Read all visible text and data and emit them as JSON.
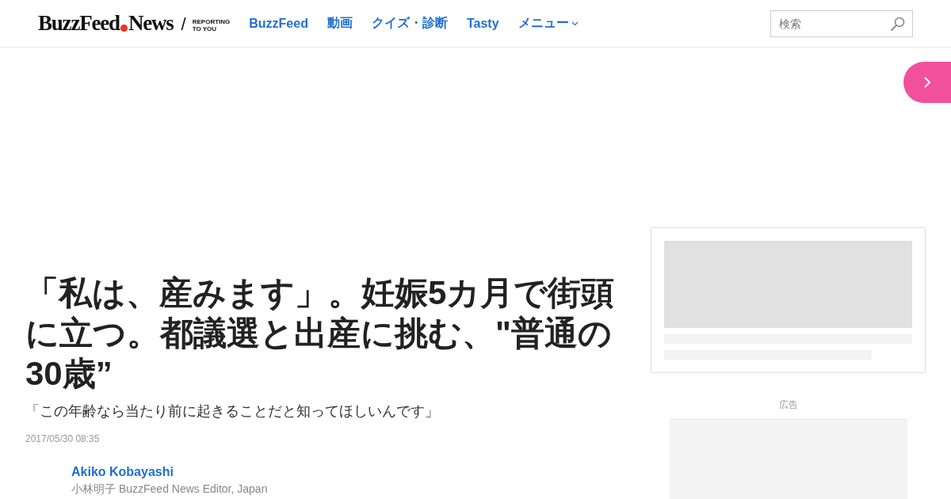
{
  "header": {
    "logo": {
      "brand": "BuzzFeed",
      "suffix": "News",
      "slash": "/",
      "tagline": [
        "REPORTING",
        "TO YOU"
      ]
    },
    "nav": [
      {
        "label": "BuzzFeed",
        "dropdown": false
      },
      {
        "label": "動画",
        "dropdown": false
      },
      {
        "label": "クイズ・診断",
        "dropdown": false
      },
      {
        "label": "Tasty",
        "dropdown": false
      },
      {
        "label": "メニュー",
        "dropdown": true
      }
    ],
    "search": {
      "placeholder": "検索"
    }
  },
  "article": {
    "title": "「私は、産みます」。妊娠5カ月で街頭に立つ。都議選と出産に挑む、\"普通の30歳”",
    "subtitle": "「この年齢なら当たり前に起きることだと知ってほしいんです」",
    "date": "2017/05/30 08:35",
    "author": {
      "name": "Akiko Kobayashi",
      "description": "小林明子 BuzzFeed News Editor, Japan"
    }
  },
  "sidebar": {
    "ad_label": "広告"
  }
}
